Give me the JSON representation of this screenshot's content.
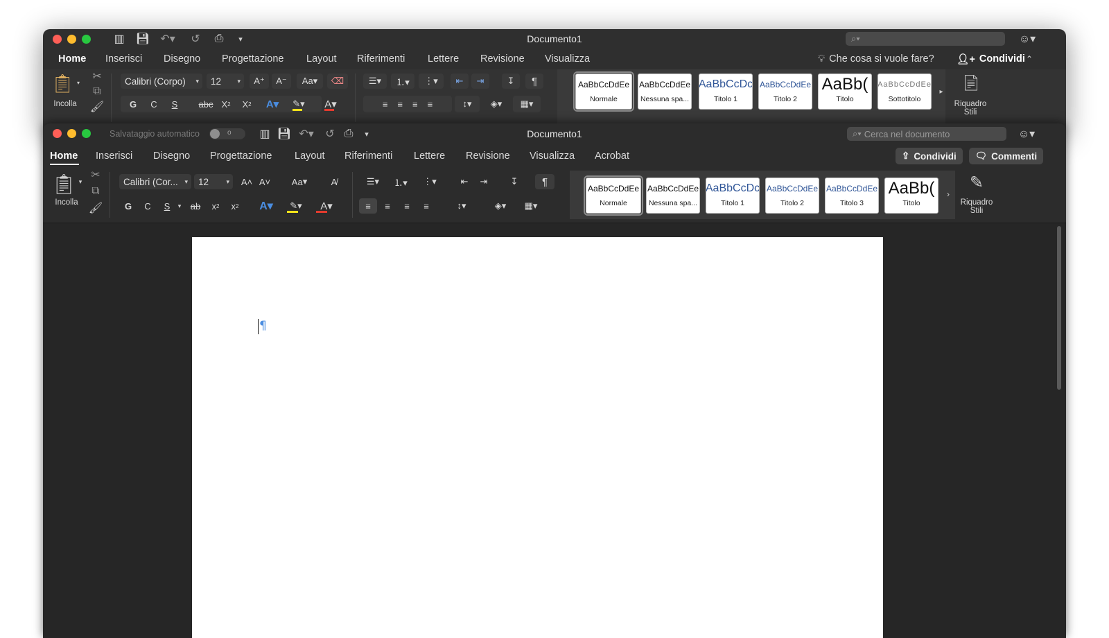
{
  "back_window": {
    "title": "Documento1",
    "tabs": [
      "Home",
      "Inserisci",
      "Disegno",
      "Progettazione",
      "Layout",
      "Riferimenti",
      "Lettere",
      "Revisione",
      "Visualizza"
    ],
    "tell_me": "Che cosa si vuole fare?",
    "share": "Condividi",
    "paste_label": "Incolla",
    "font_name": "Calibri (Corpo)",
    "font_size": "12",
    "styles": [
      {
        "sample": "AaBbCcDdEe",
        "name": "Normale"
      },
      {
        "sample": "AaBbCcDdEe",
        "name": "Nessuna spa..."
      },
      {
        "sample": "AaBbCcDc",
        "name": "Titolo 1"
      },
      {
        "sample": "AaBbCcDdEe",
        "name": "Titolo 2"
      },
      {
        "sample": "AaBb(",
        "name": "Titolo"
      },
      {
        "sample": "AaBbCcDdEe",
        "name": "Sottotitolo"
      }
    ],
    "styles_pane": "Riquadro Stili",
    "format_buttons": {
      "bold": "G",
      "italic": "C",
      "underline": "S",
      "strike": "abc",
      "sub": "X",
      "sup": "X"
    }
  },
  "front_window": {
    "title": "Documento1",
    "autosave_label": "Salvataggio automatico",
    "autosave_state": "o",
    "search_placeholder": "Cerca nel documento",
    "tabs": [
      "Home",
      "Inserisci",
      "Disegno",
      "Progettazione",
      "Layout",
      "Riferimenti",
      "Lettere",
      "Revisione",
      "Visualizza",
      "Acrobat"
    ],
    "share": "Condividi",
    "comments": "Commenti",
    "paste_label": "Incolla",
    "font_name": "Calibri (Cor...",
    "font_size": "12",
    "change_case": "Aa",
    "styles": [
      {
        "sample": "AaBbCcDdEe",
        "name": "Normale"
      },
      {
        "sample": "AaBbCcDdEe",
        "name": "Nessuna spa..."
      },
      {
        "sample": "AaBbCcDc",
        "name": "Titolo 1"
      },
      {
        "sample": "AaBbCcDdEe",
        "name": "Titolo 2"
      },
      {
        "sample": "AaBbCcDdEe",
        "name": "Titolo 3"
      },
      {
        "sample": "AaBb(",
        "name": "Titolo"
      }
    ],
    "styles_pane_1": "Riquadro",
    "styles_pane_2": "Stili",
    "format_buttons": {
      "bold": "G",
      "italic": "C",
      "underline": "S",
      "strike": "ab",
      "sub": "x",
      "sup": "x"
    },
    "pilcrow": "¶"
  },
  "colors": {
    "accent_blue": "#4a8de0",
    "font_red": "#e23b2e",
    "highlight_yellow": "#f2e21b"
  }
}
